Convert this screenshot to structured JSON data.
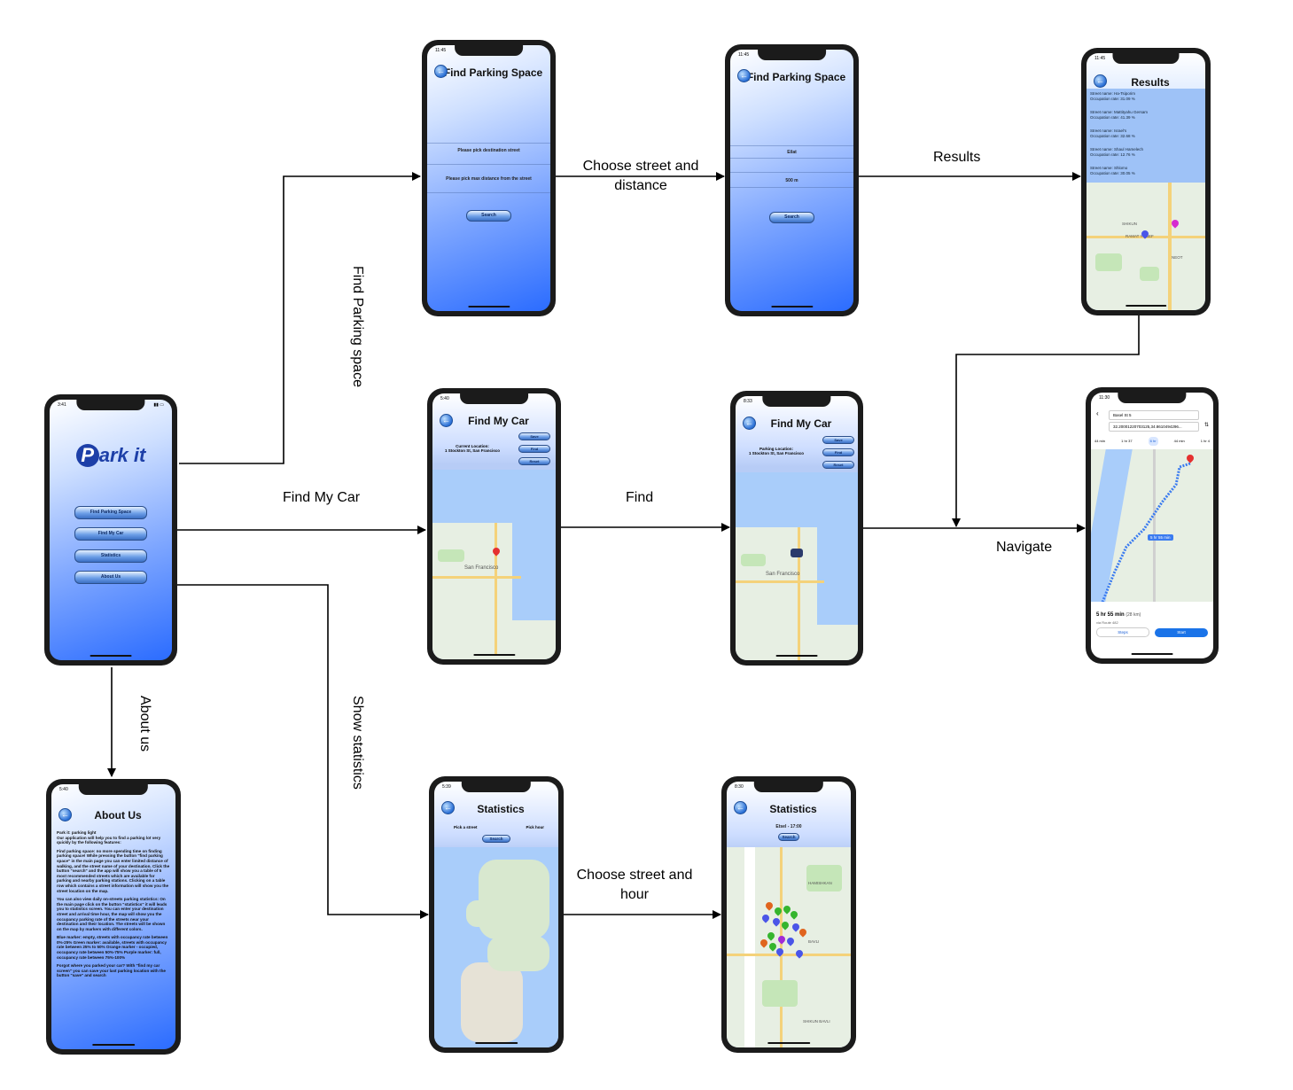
{
  "edges": {
    "find_parking_space": "Find Parking space",
    "find_my_car": "Find My Car",
    "about_us": "About us",
    "show_statistics": "Show statistics",
    "choose_street_distance": "Choose street and distance",
    "results": "Results",
    "find": "Find",
    "navigate": "Navigate",
    "choose_street_hour": "Choose street and hour"
  },
  "home_screen": {
    "time": "3:41",
    "logo_p": "P",
    "logo_rest": "ark it",
    "buttons": [
      "Find Parking Space",
      "Find My Car",
      "Statistics",
      "About Us"
    ]
  },
  "parking_screen_1": {
    "time": "11:45",
    "title": "Find Parking Space",
    "destination_prompt": "Please pick destination street",
    "distance_prompt": "Please pick max distance from the street",
    "search": "Search"
  },
  "parking_screen_2": {
    "time": "11:45",
    "title": "Find Parking Space",
    "street": "Eilat",
    "distance": "500 m",
    "search": "Search"
  },
  "results_screen": {
    "time": "11:45",
    "title": "Results",
    "rows": [
      {
        "street": "Street name: Ha-Tsiporim",
        "rate": "Occupation rate: 31.09 %"
      },
      {
        "street": "Street name: Mattityahu Gersam",
        "rate": "Occupation rate: 41.39 %"
      },
      {
        "street": "Street name: Israel's",
        "rate": "Occupation rate: 32.68 %"
      },
      {
        "street": "Street name: Shaul Hamelech",
        "rate": "Occupation rate: 12.76 %"
      },
      {
        "street": "Street name: Shlomo",
        "rate": "Occupation rate: 30.05 %"
      }
    ],
    "map_labels": [
      "SHIKUN",
      "RAMAT YOSEF",
      "NEOT"
    ]
  },
  "car_screen_1": {
    "time": "5:40",
    "title": "Find My Car",
    "location_label": "Current Location:",
    "location_value": "1 Stockton St, San Francisco",
    "buttons": [
      "Save",
      "Find",
      "Reset"
    ],
    "city": "San Francisco"
  },
  "car_screen_2": {
    "time": "8:33",
    "title": "Find My Car",
    "location_label": "Parking Location:",
    "location_value": "1 Stockton St, San Francisco",
    "buttons": [
      "Save",
      "Find",
      "Reset"
    ],
    "city": "San Francisco"
  },
  "navigate_screen": {
    "time": "11:30",
    "from": "Basel St 5",
    "to": "32.20001220703125,34.8610494296...",
    "modes": [
      "44 min",
      "1 hr 37",
      "6 hr",
      "44 min",
      "1 hr 4"
    ],
    "duration": "5 hr 55 min",
    "distance": "(28 km)",
    "via": "via Route 482",
    "steps": "Steps",
    "start": "Start",
    "badge": "5 hr 55 min"
  },
  "stats_screen_1": {
    "time": "5:39",
    "title": "Statistics",
    "pick_street": "Pick a street",
    "pick_hour": "Pick hour",
    "search": "Search"
  },
  "stats_screen_2": {
    "time": "8:30",
    "title": "Statistics",
    "selection": "Etsel - 17:00",
    "search": "Search",
    "map_labels": [
      "HAMISHKAN",
      "BAVLI",
      "SHIKUN BAVLI"
    ]
  },
  "about_screen": {
    "time": "5:40",
    "title": "About Us",
    "paragraphs": [
      "Park it: parking light",
      "Our application will help you to find a parking lot very quickly by the following features:",
      "Find parking space: no more spending time on finding parking space! While pressing the button \"find parking space\" in the main page you can enter limited distance of walking, and the street name of your destination. Click the button \"search\" and the app will show you a table of 5 most recommended streets which are available for parking and nearby parking stations. Clicking on a table row which contains a street information will show you the street location on the map.",
      "You can also view daily on-streets parking statistics: On the main page click on the button \"statistics\" it will leads you to statistics screen. You can enter your destination street and arrival time hour, the map will show you the occupancy parking rate of the streets near your destination and their location. The streets will be shown on the map by markers with different colors.",
      "Blue marker: empty, streets with occupancy rate between 0%-25% Green marker: available, streets with occupancy rate between 25% to 50% Orange marker - occupied, occupancy rate between 50%-75% Purple marker: full, occupancy rate between 75%-100%",
      "Forgot where you parked your car? With \"find my car screen\" you can save your last parking location with the button \"save\" and search"
    ]
  },
  "colors": {
    "edge": "#000000",
    "gradient_top": "#ffffff",
    "gradient_bottom": "#2b6cff",
    "marker_blue": "#4a55e8",
    "marker_green": "#35b52e",
    "marker_orange": "#e0641e",
    "marker_purple": "#a12bd6",
    "route": "#3a7bf0"
  }
}
